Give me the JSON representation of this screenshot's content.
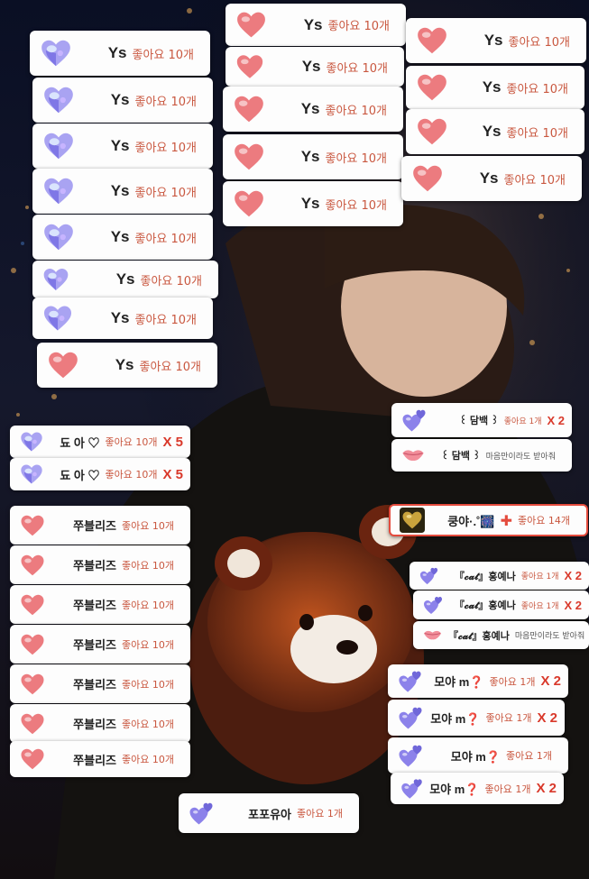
{
  "brand": {
    "like_color": "#c9573f",
    "multiplier_color": "#d9392b",
    "accent_border": "#e44b3d"
  },
  "cards": [
    {
      "id": "c1",
      "icon": "opal-heart-icon",
      "name": "Ys",
      "likes": "좋아요 10개",
      "mult": "",
      "size": "l"
    },
    {
      "id": "c2",
      "icon": "opal-heart-icon",
      "name": "Ys",
      "likes": "좋아요 10개",
      "mult": "",
      "size": "l"
    },
    {
      "id": "c3",
      "icon": "opal-heart-icon",
      "name": "Ys",
      "likes": "좋아요 10개",
      "mult": "",
      "size": "l"
    },
    {
      "id": "c4",
      "icon": "opal-heart-icon",
      "name": "Ys",
      "likes": "좋아요 10개",
      "mult": "",
      "size": "l"
    },
    {
      "id": "c5",
      "icon": "opal-heart-icon",
      "name": "Ys",
      "likes": "좋아요 10개",
      "mult": "",
      "size": "l"
    },
    {
      "id": "c6",
      "icon": "opal-heart-icon",
      "name": "Ys",
      "likes": "좋아요 10개",
      "mult": "",
      "size": "l"
    },
    {
      "id": "c7",
      "icon": "opal-heart-icon",
      "name": "Ys",
      "likes": "좋아요 10개",
      "mult": "",
      "size": "l"
    },
    {
      "id": "c8",
      "icon": "pink-heart-icon",
      "name": "Ys",
      "likes": "좋아요 10개",
      "mult": "",
      "size": "l"
    },
    {
      "id": "c9",
      "icon": "pink-heart-icon",
      "name": "Ys",
      "likes": "좋아요 10개",
      "mult": "",
      "size": "l"
    },
    {
      "id": "c10",
      "icon": "pink-heart-icon",
      "name": "Ys",
      "likes": "좋아요 10개",
      "mult": "",
      "size": "l"
    },
    {
      "id": "c11",
      "icon": "pink-heart-icon",
      "name": "Ys",
      "likes": "좋아요 10개",
      "mult": "",
      "size": "l"
    },
    {
      "id": "c12",
      "icon": "pink-heart-icon",
      "name": "Ys",
      "likes": "좋아요 10개",
      "mult": "",
      "size": "l"
    },
    {
      "id": "c13",
      "icon": "pink-heart-icon",
      "name": "Ys",
      "likes": "좋아요 10개",
      "mult": "",
      "size": "l"
    },
    {
      "id": "c14",
      "icon": "pink-heart-icon",
      "name": "Ys",
      "likes": "좋아요 10개",
      "mult": "",
      "size": "l"
    },
    {
      "id": "c15",
      "icon": "pink-heart-icon",
      "name": "Ys",
      "likes": "좋아요 10개",
      "mult": "",
      "size": "l"
    },
    {
      "id": "c16",
      "icon": "pink-heart-icon",
      "name": "Ys",
      "likes": "좋아요 10개",
      "mult": "",
      "size": "l"
    },
    {
      "id": "c17",
      "icon": "pink-heart-icon",
      "name": "Ys",
      "likes": "좋아요 10개",
      "mult": "",
      "size": "l"
    },
    {
      "id": "c18",
      "icon": "opal-heart-icon",
      "name": "됴 아 ♡",
      "likes": "좋아요 10개",
      "mult": "X 5",
      "size": "m"
    },
    {
      "id": "c19",
      "icon": "opal-heart-icon",
      "name": "됴 아 ♡",
      "likes": "좋아요 10개",
      "mult": "X 5",
      "size": "m"
    },
    {
      "id": "c20",
      "icon": "pink-heart-icon",
      "name": "쭈블리즈",
      "likes": "좋아요 10개",
      "mult": "",
      "size": "m"
    },
    {
      "id": "c21",
      "icon": "pink-heart-icon",
      "name": "쭈블리즈",
      "likes": "좋아요 10개",
      "mult": "",
      "size": "m"
    },
    {
      "id": "c22",
      "icon": "pink-heart-icon",
      "name": "쭈블리즈",
      "likes": "좋아요 10개",
      "mult": "",
      "size": "m"
    },
    {
      "id": "c23",
      "icon": "pink-heart-icon",
      "name": "쭈블리즈",
      "likes": "좋아요 10개",
      "mult": "",
      "size": "m"
    },
    {
      "id": "c24",
      "icon": "pink-heart-icon",
      "name": "쭈블리즈",
      "likes": "좋아요 10개",
      "mult": "",
      "size": "m"
    },
    {
      "id": "c25",
      "icon": "pink-heart-icon",
      "name": "쭈블리즈",
      "likes": "좋아요 10개",
      "mult": "",
      "size": "m"
    },
    {
      "id": "c26",
      "icon": "pink-heart-icon",
      "name": "쭈블리즈",
      "likes": "좋아요 10개",
      "mult": "",
      "size": "m"
    },
    {
      "id": "c27",
      "icon": "purple-hearts-icon",
      "name": "포포유아",
      "likes": "좋아요 1개",
      "mult": "",
      "size": "m"
    },
    {
      "id": "c28",
      "icon": "purple-hearts-icon",
      "name": "꒰ 담백 ꒱",
      "likes": "좋아요 1개",
      "mult": "X 2",
      "size": "s"
    },
    {
      "id": "c29",
      "icon": "lips-icon",
      "name": "꒰ 담백 ꒱",
      "likes": "마음만이라도 받아줘",
      "mult": "",
      "size": "s"
    },
    {
      "id": "c30",
      "icon": "gold-heart-icon",
      "name": "쿵야·.˚🎆",
      "likes": "좋아요 14개",
      "mult": "",
      "size": "m",
      "plus": "✚",
      "red": true
    },
    {
      "id": "c31",
      "icon": "purple-hearts-icon",
      "name": "『𝓬𝓪𝓽』홍예나",
      "likes": "좋아요 1개",
      "mult": "X 2",
      "size": "s"
    },
    {
      "id": "c32",
      "icon": "purple-hearts-icon",
      "name": "『𝓬𝓪𝓽』홍예나",
      "likes": "좋아요 1개",
      "mult": "X 2",
      "size": "s"
    },
    {
      "id": "c33",
      "icon": "lips-icon",
      "name": "『𝓬𝓪𝓽』홍예나",
      "likes": "마음만이라도 받아줘",
      "mult": "",
      "size": "s"
    },
    {
      "id": "c34",
      "icon": "purple-hearts-icon",
      "name": "모야 m❓",
      "likes": "좋아요 1개",
      "mult": "X 2",
      "size": "m"
    },
    {
      "id": "c35",
      "icon": "purple-hearts-icon",
      "name": "모야 m❓",
      "likes": "좋아요 1개",
      "mult": "X 2",
      "size": "m"
    },
    {
      "id": "c36",
      "icon": "purple-hearts-icon",
      "name": "모야 m❓",
      "likes": "좋아요 1개",
      "mult": "",
      "size": "m"
    },
    {
      "id": "c37",
      "icon": "purple-hearts-icon",
      "name": "모야 m❓",
      "likes": "좋아요 1개",
      "mult": "X 2",
      "size": "m"
    }
  ]
}
